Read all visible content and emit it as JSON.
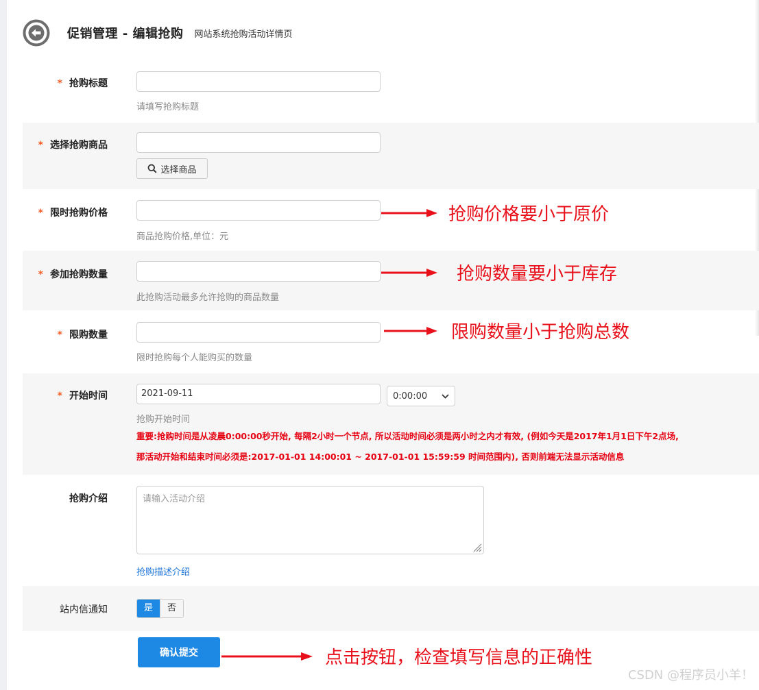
{
  "header": {
    "title": "促销管理 - 编辑抢购",
    "subtitle": "网站系统抢购活动详情页"
  },
  "form": {
    "title": {
      "label": "抢购标题",
      "value": "",
      "help": "请填写抢购标题"
    },
    "goods": {
      "label": "选择抢购商品",
      "value": "",
      "button": "选择商品"
    },
    "price": {
      "label": "限时抢购价格",
      "value": "",
      "help": "商品抢购价格,单位：元"
    },
    "quantity": {
      "label": "参加抢购数量",
      "value": "",
      "help": "此抢购活动最多允许抢购的商品数量"
    },
    "limit": {
      "label": "限购数量",
      "value": "",
      "help": "限时抢购每个人能购买的数量"
    },
    "start_time": {
      "label": "开始时间",
      "date": "2021-09-11",
      "time": "0:00:00",
      "help": "抢购开始时间",
      "warning_line1": "重要:抢购时间是从凌晨0:00:00秒开始, 每隔2小时一个节点, 所以活动时间必须是两小时之内才有效, (例如今天是2017年1月1日下午2点场,",
      "warning_line2": "那活动开始和结束时间必须是:2017-01-01 14:00:01 ~ 2017-01-01 15:59:59 时间范围内), 否则前端无法显示活动信息"
    },
    "intro": {
      "label": "抢购介绍",
      "placeholder": "请输入活动介绍",
      "help": "抢购描述介绍"
    },
    "notify": {
      "label": "站内信通知",
      "yes": "是",
      "no": "否",
      "selected": "是"
    },
    "required_mark": "*",
    "submit": "确认提交"
  },
  "annotations": {
    "price": "抢购价格要小于原价",
    "quantity": "抢购数量要小于库存",
    "limit": "限购数量小于抢购总数",
    "submit": "点击按钮，检查填写信息的正确性"
  },
  "watermark": "CSDN @程序员小羊！",
  "colors": {
    "primary": "#1e88e5",
    "required": "#f15a24",
    "warning": "#e60012",
    "annotation": "#e8101a",
    "link": "#1a73d9"
  },
  "icons": [
    "back-arrow-icon",
    "search-icon",
    "chevron-down-icon",
    "resize-handle-icon"
  ]
}
